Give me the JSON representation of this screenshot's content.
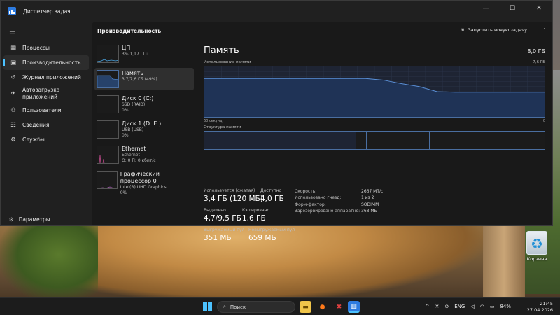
{
  "window": {
    "title": "Диспетчер задач"
  },
  "nav": {
    "items": [
      {
        "label": "Процессы",
        "icon": "processes-icon"
      },
      {
        "label": "Производительность",
        "icon": "performance-icon"
      },
      {
        "label": "Журнал приложений",
        "icon": "app-history-icon"
      },
      {
        "label": "Автозагрузка приложений",
        "icon": "startup-icon"
      },
      {
        "label": "Пользователи",
        "icon": "users-icon"
      },
      {
        "label": "Сведения",
        "icon": "details-icon"
      },
      {
        "label": "Службы",
        "icon": "services-icon"
      }
    ],
    "settings": "Параметры"
  },
  "header": {
    "title": "Производительность",
    "run_task": "Запустить новую задачу"
  },
  "devices": [
    {
      "name": "ЦП",
      "sub1": "3% 1,17 ГГц",
      "sub2": ""
    },
    {
      "name": "Память",
      "sub1": "3,7/7,6 ГБ (49%)",
      "sub2": ""
    },
    {
      "name": "Диск 0 (C:)",
      "sub1": "SSD (RAID)",
      "sub2": "0%"
    },
    {
      "name": "Диск 1 (D: E:)",
      "sub1": "USB (USB)",
      "sub2": "0%"
    },
    {
      "name": "Ethernet",
      "sub1": "Ethernet",
      "sub2": "О: 0 П: 0 кбит/с"
    },
    {
      "name": "Графический процессор 0",
      "sub1": "Intel(R) UHD Graphics",
      "sub2": "0%"
    }
  ],
  "memory": {
    "title": "Память",
    "total": "8,0 ГБ",
    "usage_label": "Использование памяти",
    "usage_max": "7,6 ГБ",
    "axis_left": "60 секунд",
    "axis_right": "0",
    "structure_label": "Структура памяти",
    "usage_fraction_history": [
      0.76,
      0.76,
      0.76,
      0.76,
      0.76,
      0.76,
      0.76,
      0.76,
      0.76,
      0.76,
      0.73,
      0.66,
      0.6,
      0.5,
      0.49,
      0.49,
      0.49,
      0.49,
      0.49,
      0.49
    ],
    "stats": {
      "in_use_label": "Используется (сжатая)",
      "in_use_value": "3,4 ГБ (120 МБ)",
      "available_label": "Доступно",
      "available_value": "4,0 ГБ",
      "committed_label": "Выделено",
      "committed_value": "4,7/9,5 ГБ",
      "cached_label": "Кэшировано",
      "cached_value": "1,6 ГБ",
      "paged_label": "Выгружаемый пул",
      "paged_value": "351 МБ",
      "nonpaged_label": "Невыгружаемый пул",
      "nonpaged_value": "659 МБ"
    },
    "details": [
      {
        "k": "Скорость:",
        "v": "2667 МТ/с"
      },
      {
        "k": "Использовано гнезд:",
        "v": "1 из 2"
      },
      {
        "k": "Форм-фактор:",
        "v": "SODIMM"
      },
      {
        "k": "Зарезервировано аппаратно:",
        "v": "368 МБ"
      }
    ]
  },
  "desktop": {
    "recycle_bin": "Корзина"
  },
  "taskbar": {
    "search_placeholder": "Поиск",
    "lang": "ENG",
    "battery": "84%",
    "time": "21:45",
    "date": "27.04.2026"
  }
}
